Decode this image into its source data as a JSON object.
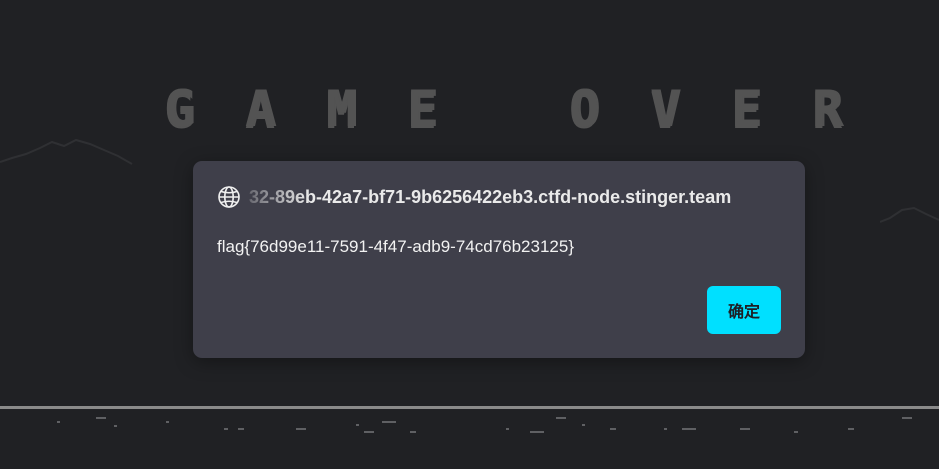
{
  "game": {
    "title_letters": [
      "G",
      "A",
      "M",
      "E",
      " ",
      "O",
      "V",
      "E",
      "R"
    ],
    "colors": {
      "background": "#202124",
      "text": "#535353",
      "horizon": "#8a8a8a"
    }
  },
  "dialog": {
    "icon": "globe-icon",
    "origin": "32-89eb-42a7-bf71-9b6256422eb3.ctfd-node.stinger.team",
    "message": "flag{76d99e11-7591-4f47-adb9-74cd76b23125}",
    "ok_label": "确定",
    "colors": {
      "background": "#3f3f4a",
      "button": "#00e0ff"
    }
  }
}
